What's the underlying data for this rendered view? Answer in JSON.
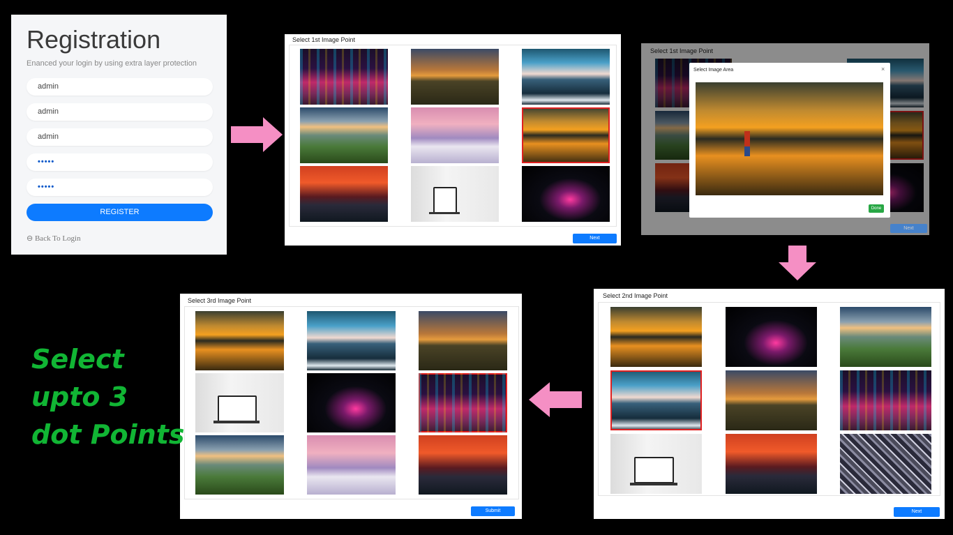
{
  "registration": {
    "title": "Registration",
    "subtitle": "Enanced your login by using extra layer protection",
    "fields": [
      "admin",
      "admin",
      "admin",
      "•••••",
      "•••••"
    ],
    "register_label": "REGISTER",
    "back_label": "Back To Login"
  },
  "panel1": {
    "title": "Select 1st Image Point",
    "next_label": "Next"
  },
  "panel2": {
    "title": "Select 1st Image Point",
    "modal_title": "Select Image Area",
    "close_glyph": "×",
    "done_label": "Done",
    "next_label": "Next"
  },
  "panel3": {
    "title": "Select 2nd Image Point",
    "next_label": "Next"
  },
  "panel4": {
    "title": "Select 3rd Image Point",
    "submit_label": "Submit"
  },
  "heading": {
    "line1": "Select",
    "line2": "upto 3",
    "line3": "dot Points"
  },
  "colors": {
    "arrow": "#f58fc4",
    "accent": "#0d7bff",
    "done": "#28a745",
    "selected_border": "#e02020",
    "heading": "#11b534"
  }
}
